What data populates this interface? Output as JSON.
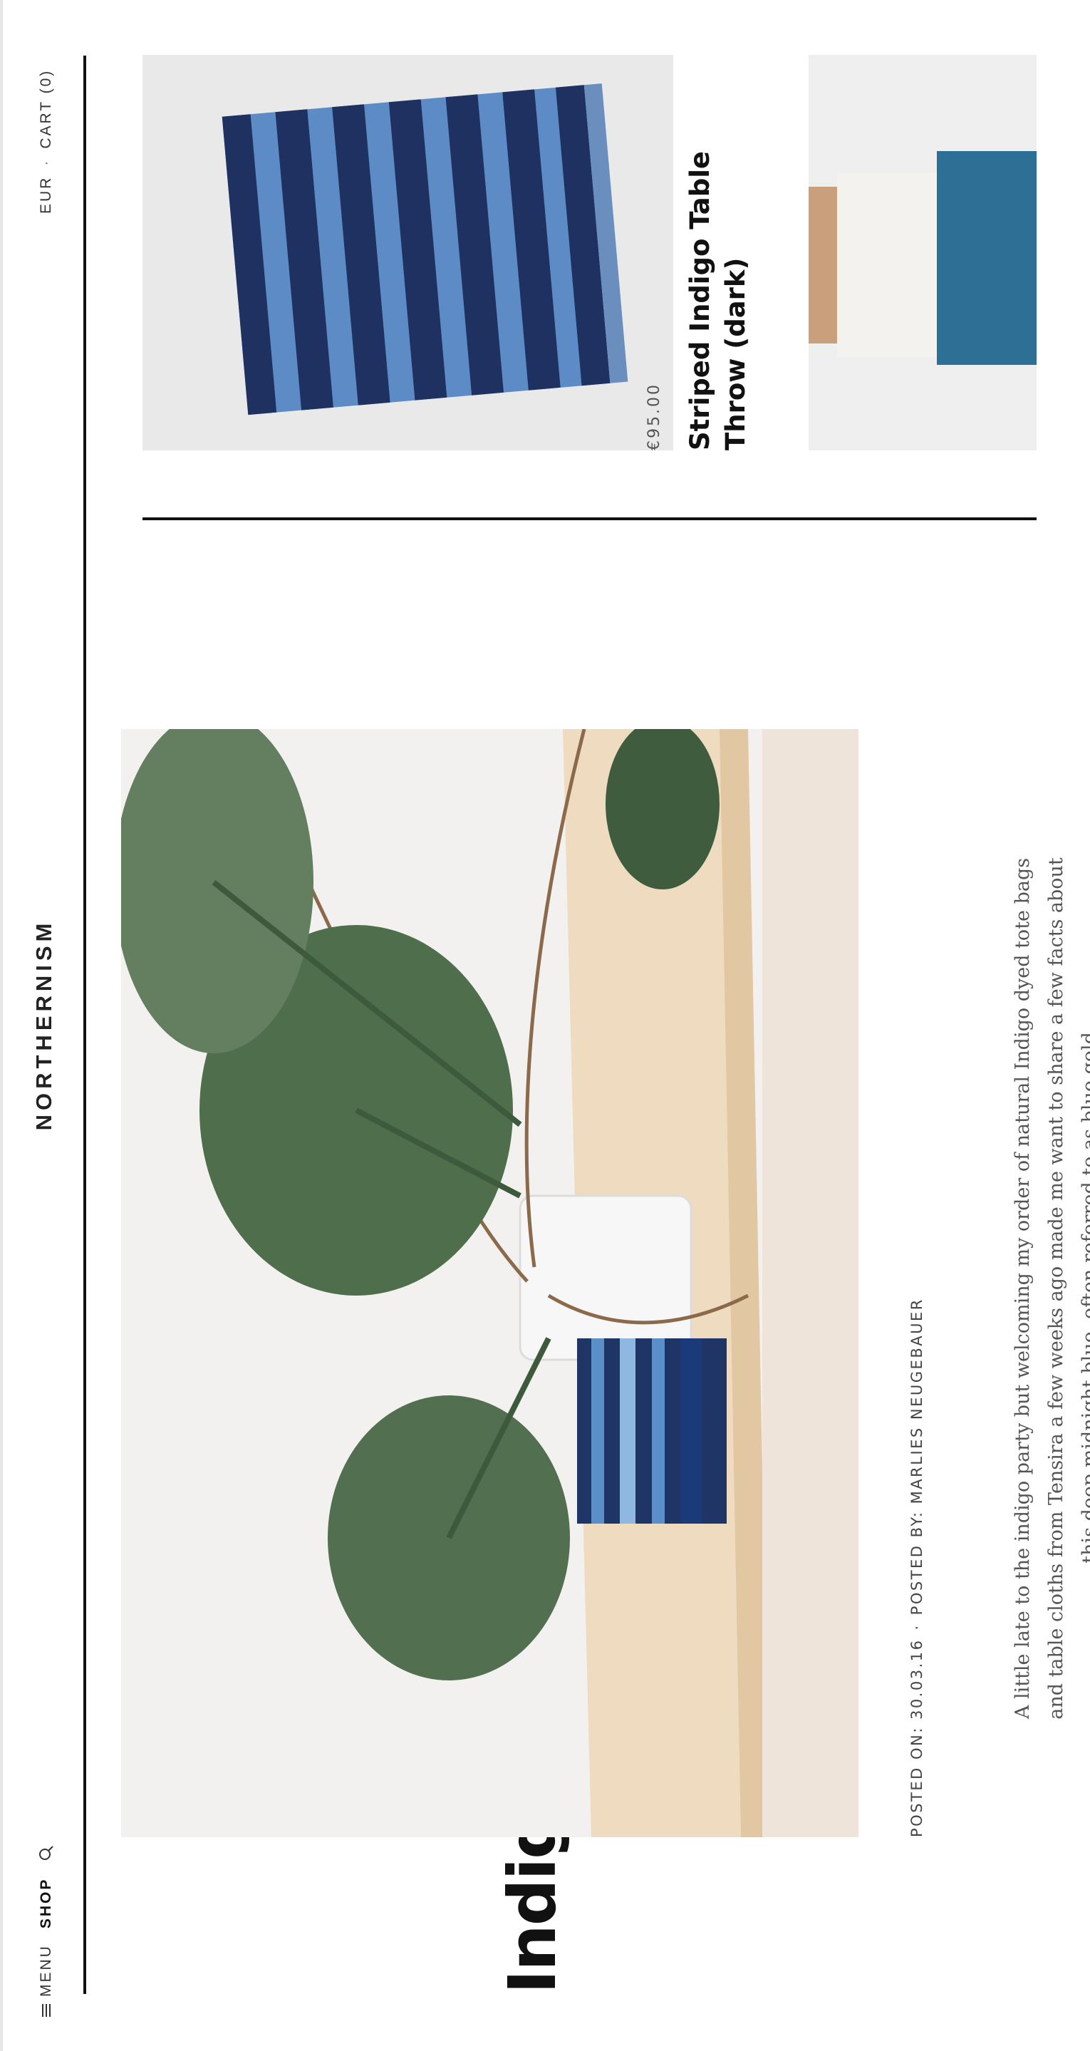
{
  "header": {
    "brand": "NORTHERNISM",
    "menu_label": "MENU",
    "shop_label": "SHOP",
    "currency": "EUR",
    "separator": "·",
    "cart_label": "CART (0)"
  },
  "article": {
    "title": "Indigo",
    "posted_on": "POSTED ON: 30.03.16",
    "meta_separator": "·",
    "posted_by": "POSTED BY: MARLIES NEUGEBAUER",
    "excerpt": "A little late to the indigo party but welcoming my order of natural Indigo dyed tote bags and table cloths from Tensira a few weeks ago made me want to share a few facts about this deep midnight blue, often referred to as blue gold..."
  },
  "related_products": [
    {
      "price": "€95.00",
      "name": "Striped Indigo Table Throw (dark)"
    },
    {
      "price": "",
      "name": ""
    }
  ],
  "colors": {
    "text": "#111111",
    "muted": "#555555",
    "indigo_dark": "#1f3566",
    "indigo_light": "#5a8fc9",
    "leaf": "#4e6e4c",
    "wood": "#eed8b8"
  },
  "icons": {
    "menu": "hamburger-icon",
    "search": "search-icon"
  }
}
